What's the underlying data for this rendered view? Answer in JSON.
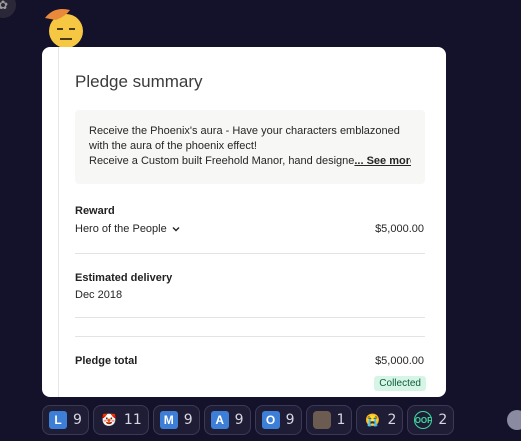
{
  "pledge_card": {
    "title": "Pledge summary",
    "description": {
      "line1": "Receive the Phoenix's aura - Have your characters emblazoned",
      "line2": "with the aura of the phoenix effect!",
      "line3": "Receive a Custom built Freehold Manor, hand designe",
      "see_more": "... See more"
    },
    "reward": {
      "label": "Reward",
      "name": "Hero of the People",
      "amount": "$5,000.00"
    },
    "delivery": {
      "label": "Estimated delivery",
      "date": "Dec 2018"
    },
    "total": {
      "label": "Pledge total",
      "amount": "$5,000.00",
      "status": "Collected"
    }
  },
  "reactions": [
    {
      "icon": "letter-l",
      "glyph": "L",
      "count": "9"
    },
    {
      "icon": "clown-icon",
      "glyph": "🤡",
      "count": "11"
    },
    {
      "icon": "letter-m",
      "glyph": "M",
      "count": "9"
    },
    {
      "icon": "letter-a",
      "glyph": "A",
      "count": "9"
    },
    {
      "icon": "letter-o",
      "glyph": "O",
      "count": "9"
    },
    {
      "icon": "person-face-icon",
      "glyph": "",
      "count": "1"
    },
    {
      "icon": "crying-face-icon",
      "glyph": "😭",
      "count": "2"
    },
    {
      "icon": "oof-icon",
      "glyph": "OOF",
      "count": "2"
    }
  ],
  "colors": {
    "background": "#14122a",
    "badge_bg": "#d7f5e6",
    "badge_text": "#0b5c3a",
    "letter_icon": "#3d7fd6"
  }
}
